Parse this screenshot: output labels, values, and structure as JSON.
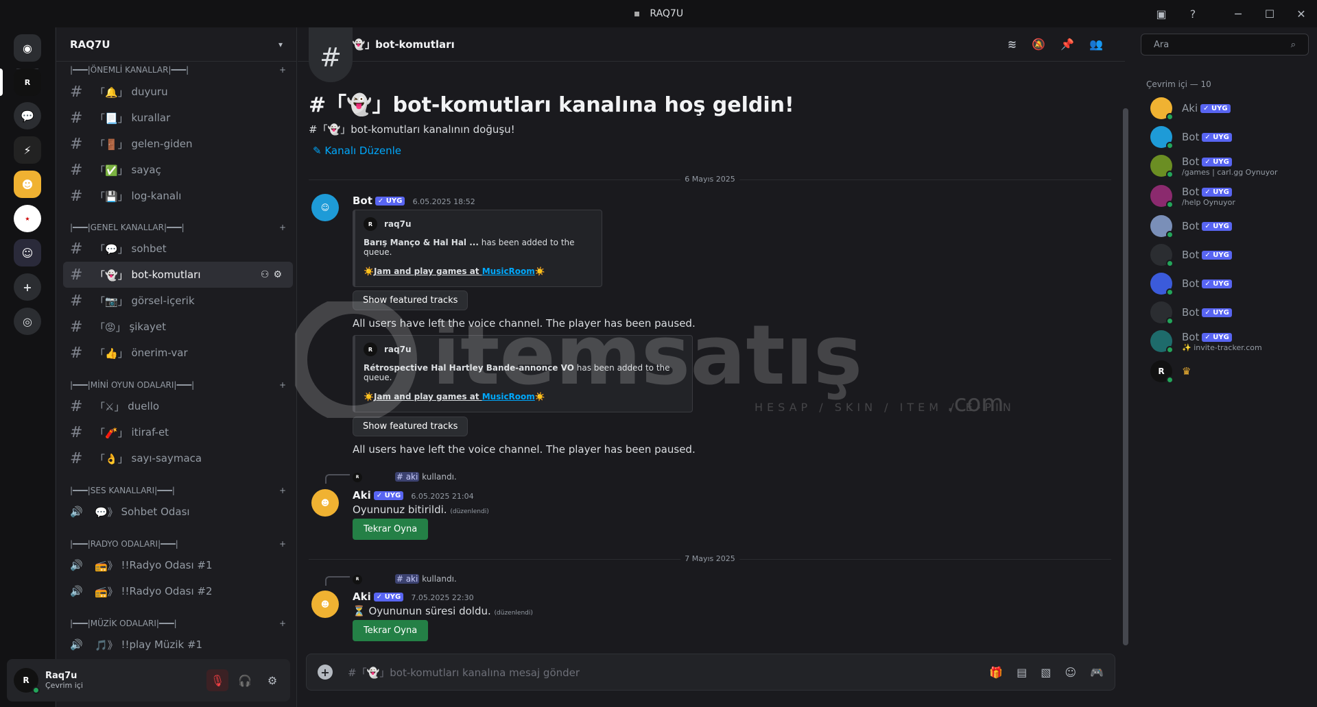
{
  "window": {
    "title": "RAQ7U"
  },
  "guild": {
    "name": "RAQ7U"
  },
  "categories": [
    {
      "name": "|━━━|ÖNEMLİ KANALLAR|━━━|",
      "channels": [
        {
          "name": "duyuru",
          "emoji": "🔔"
        },
        {
          "name": "kurallar",
          "emoji": "📃"
        },
        {
          "name": "gelen-giden",
          "emoji": "🚪"
        },
        {
          "name": "sayaç",
          "emoji": "✅"
        },
        {
          "name": "log-kanalı",
          "emoji": "💾"
        }
      ]
    },
    {
      "name": "|━━━|GENEL KANALLAR|━━━|",
      "channels": [
        {
          "name": "sohbet",
          "emoji": "💬"
        },
        {
          "name": "bot-komutları",
          "emoji": "👻"
        },
        {
          "name": "görsel-içerik",
          "emoji": "📷"
        },
        {
          "name": "şikayet",
          "emoji": "😡"
        },
        {
          "name": "önerim-var",
          "emoji": "👍"
        }
      ]
    },
    {
      "name": "|━━━|MİNİ OYUN ODALARI|━━━|",
      "channels": [
        {
          "name": "duello",
          "emoji": "⚔"
        },
        {
          "name": "itiraf-et",
          "emoji": "🧨"
        },
        {
          "name": "sayı-saymaca",
          "emoji": "👌"
        }
      ]
    },
    {
      "name": "|━━━|SES KANALLARI|━━━|",
      "channels": [
        {
          "name": "Sohbet Odası",
          "emoji": "💬》"
        }
      ]
    },
    {
      "name": "|━━━|RADYO ODALARI|━━━|",
      "channels": [
        {
          "name": "!!Radyo Odası #1",
          "emoji": "📻》"
        },
        {
          "name": "!!Radyo Odası #2",
          "emoji": "📻》"
        }
      ]
    },
    {
      "name": "|━━━|MÜZİK ODALARI|━━━|",
      "channels": [
        {
          "name": "!!play Müzik #1",
          "emoji": "🎵》"
        }
      ]
    }
  ],
  "active_channel": {
    "name": "bot-komutları",
    "bracket_name": "「👻」bot-komutları"
  },
  "user_panel": {
    "name": "Raq7u",
    "status": "Çevrim içi"
  },
  "search": {
    "placeholder": "Ara"
  },
  "welcome": {
    "title": "#「👻」bot-komutları kanalına hoş geldin!",
    "subtitle": "#「👻」bot-komutları kanalının doğuşu!",
    "edit": "Kanalı Düzenle"
  },
  "dates": [
    "6 Mayıs 2025",
    "7 Mayıs 2025"
  ],
  "messages": [
    {
      "author": "Bot",
      "tag": "UYG",
      "time": "6.05.2025 18:52",
      "embed1": {
        "user": "raq7u",
        "text_bold": "Barış Manço & Hal Hal ...",
        "text": "has been added to the queue.",
        "promo_pre": "☀️",
        "promo_text": "Jam and play games at ",
        "promo_link": "MusicRoom",
        "promo_post": "☀️"
      },
      "button1": "Show featured tracks",
      "note1": "All users have left the voice channel. The player has been paused.",
      "embed2": {
        "user": "raq7u",
        "text_bold": "Rétrospective Hal Hartley Bande-annonce VO",
        "text": "has been added to the queue."
      },
      "button2": "Show featured tracks",
      "note2": "All users have left the voice channel. The player has been paused."
    },
    {
      "reply_cmd": "aki",
      "reply_text": "kullandı.",
      "author": "Aki",
      "tag": "UYG",
      "time": "6.05.2025 21:04",
      "text": "Oyununuz bitirildi.",
      "edited": "(düzenlendi)",
      "button": "Tekrar Oyna"
    },
    {
      "reply_cmd": "aki",
      "reply_text": "kullandı.",
      "author": "Aki",
      "tag": "UYG",
      "time": "7.05.2025 22:30",
      "text": "⏳ Oyununun süresi doldu.",
      "edited": "(düzenlendi)",
      "button": "Tekrar Oyna"
    }
  ],
  "composer": {
    "placeholder": "#「👻」bot-komutları kanalına mesaj gönder"
  },
  "members": {
    "header": "Çevrim içi — 10",
    "list": [
      {
        "name": "Aki",
        "tag": "UYG",
        "activity": "",
        "color": "#f0b232"
      },
      {
        "name": "Bot",
        "tag": "UYG",
        "activity": "",
        "color": "#1e9bd7"
      },
      {
        "name": "Bot",
        "tag": "UYG",
        "activity": "/games | carl.gg Oynuyor",
        "color": "#6b8e23"
      },
      {
        "name": "Bot",
        "tag": "UYG",
        "activity": "/help Oynuyor",
        "color": "#8b2a6e"
      },
      {
        "name": "Bot",
        "tag": "UYG",
        "activity": "",
        "color": "#7a8fb8"
      },
      {
        "name": "Bot",
        "tag": "UYG",
        "activity": "",
        "color": "#2b2d31"
      },
      {
        "name": "Bot",
        "tag": "UYG",
        "activity": "",
        "color": "#3b5bdb"
      },
      {
        "name": "Bot",
        "tag": "UYG",
        "activity": "",
        "color": "#2b2d31"
      },
      {
        "name": "Bot",
        "tag": "UYG",
        "activity": "✨ invite-tracker.com",
        "color": "#1e6b6b"
      },
      {
        "name": "",
        "tag": "",
        "activity": "",
        "color": "#111"
      }
    ]
  },
  "watermark": {
    "brand": "itemsatış",
    "tagline": "HESAP / SKIN / ITEM / E-PIN",
    "suffix": ".com"
  }
}
